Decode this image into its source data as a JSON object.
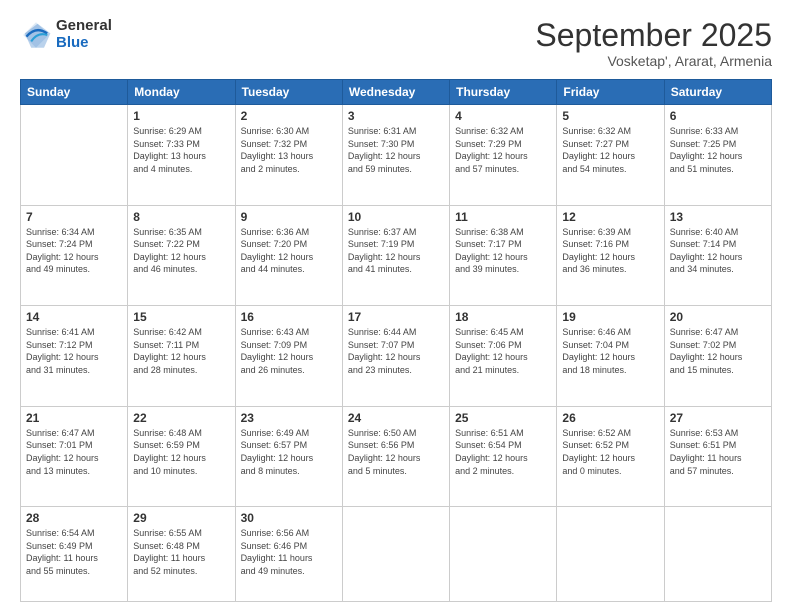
{
  "logo": {
    "general": "General",
    "blue": "Blue"
  },
  "header": {
    "month": "September 2025",
    "location": "Vosketap', Ararat, Armenia"
  },
  "weekdays": [
    "Sunday",
    "Monday",
    "Tuesday",
    "Wednesday",
    "Thursday",
    "Friday",
    "Saturday"
  ],
  "weeks": [
    [
      {
        "day": "",
        "info": ""
      },
      {
        "day": "1",
        "info": "Sunrise: 6:29 AM\nSunset: 7:33 PM\nDaylight: 13 hours\nand 4 minutes."
      },
      {
        "day": "2",
        "info": "Sunrise: 6:30 AM\nSunset: 7:32 PM\nDaylight: 13 hours\nand 2 minutes."
      },
      {
        "day": "3",
        "info": "Sunrise: 6:31 AM\nSunset: 7:30 PM\nDaylight: 12 hours\nand 59 minutes."
      },
      {
        "day": "4",
        "info": "Sunrise: 6:32 AM\nSunset: 7:29 PM\nDaylight: 12 hours\nand 57 minutes."
      },
      {
        "day": "5",
        "info": "Sunrise: 6:32 AM\nSunset: 7:27 PM\nDaylight: 12 hours\nand 54 minutes."
      },
      {
        "day": "6",
        "info": "Sunrise: 6:33 AM\nSunset: 7:25 PM\nDaylight: 12 hours\nand 51 minutes."
      }
    ],
    [
      {
        "day": "7",
        "info": "Sunrise: 6:34 AM\nSunset: 7:24 PM\nDaylight: 12 hours\nand 49 minutes."
      },
      {
        "day": "8",
        "info": "Sunrise: 6:35 AM\nSunset: 7:22 PM\nDaylight: 12 hours\nand 46 minutes."
      },
      {
        "day": "9",
        "info": "Sunrise: 6:36 AM\nSunset: 7:20 PM\nDaylight: 12 hours\nand 44 minutes."
      },
      {
        "day": "10",
        "info": "Sunrise: 6:37 AM\nSunset: 7:19 PM\nDaylight: 12 hours\nand 41 minutes."
      },
      {
        "day": "11",
        "info": "Sunrise: 6:38 AM\nSunset: 7:17 PM\nDaylight: 12 hours\nand 39 minutes."
      },
      {
        "day": "12",
        "info": "Sunrise: 6:39 AM\nSunset: 7:16 PM\nDaylight: 12 hours\nand 36 minutes."
      },
      {
        "day": "13",
        "info": "Sunrise: 6:40 AM\nSunset: 7:14 PM\nDaylight: 12 hours\nand 34 minutes."
      }
    ],
    [
      {
        "day": "14",
        "info": "Sunrise: 6:41 AM\nSunset: 7:12 PM\nDaylight: 12 hours\nand 31 minutes."
      },
      {
        "day": "15",
        "info": "Sunrise: 6:42 AM\nSunset: 7:11 PM\nDaylight: 12 hours\nand 28 minutes."
      },
      {
        "day": "16",
        "info": "Sunrise: 6:43 AM\nSunset: 7:09 PM\nDaylight: 12 hours\nand 26 minutes."
      },
      {
        "day": "17",
        "info": "Sunrise: 6:44 AM\nSunset: 7:07 PM\nDaylight: 12 hours\nand 23 minutes."
      },
      {
        "day": "18",
        "info": "Sunrise: 6:45 AM\nSunset: 7:06 PM\nDaylight: 12 hours\nand 21 minutes."
      },
      {
        "day": "19",
        "info": "Sunrise: 6:46 AM\nSunset: 7:04 PM\nDaylight: 12 hours\nand 18 minutes."
      },
      {
        "day": "20",
        "info": "Sunrise: 6:47 AM\nSunset: 7:02 PM\nDaylight: 12 hours\nand 15 minutes."
      }
    ],
    [
      {
        "day": "21",
        "info": "Sunrise: 6:47 AM\nSunset: 7:01 PM\nDaylight: 12 hours\nand 13 minutes."
      },
      {
        "day": "22",
        "info": "Sunrise: 6:48 AM\nSunset: 6:59 PM\nDaylight: 12 hours\nand 10 minutes."
      },
      {
        "day": "23",
        "info": "Sunrise: 6:49 AM\nSunset: 6:57 PM\nDaylight: 12 hours\nand 8 minutes."
      },
      {
        "day": "24",
        "info": "Sunrise: 6:50 AM\nSunset: 6:56 PM\nDaylight: 12 hours\nand 5 minutes."
      },
      {
        "day": "25",
        "info": "Sunrise: 6:51 AM\nSunset: 6:54 PM\nDaylight: 12 hours\nand 2 minutes."
      },
      {
        "day": "26",
        "info": "Sunrise: 6:52 AM\nSunset: 6:52 PM\nDaylight: 12 hours\nand 0 minutes."
      },
      {
        "day": "27",
        "info": "Sunrise: 6:53 AM\nSunset: 6:51 PM\nDaylight: 11 hours\nand 57 minutes."
      }
    ],
    [
      {
        "day": "28",
        "info": "Sunrise: 6:54 AM\nSunset: 6:49 PM\nDaylight: 11 hours\nand 55 minutes."
      },
      {
        "day": "29",
        "info": "Sunrise: 6:55 AM\nSunset: 6:48 PM\nDaylight: 11 hours\nand 52 minutes."
      },
      {
        "day": "30",
        "info": "Sunrise: 6:56 AM\nSunset: 6:46 PM\nDaylight: 11 hours\nand 49 minutes."
      },
      {
        "day": "",
        "info": ""
      },
      {
        "day": "",
        "info": ""
      },
      {
        "day": "",
        "info": ""
      },
      {
        "day": "",
        "info": ""
      }
    ]
  ]
}
